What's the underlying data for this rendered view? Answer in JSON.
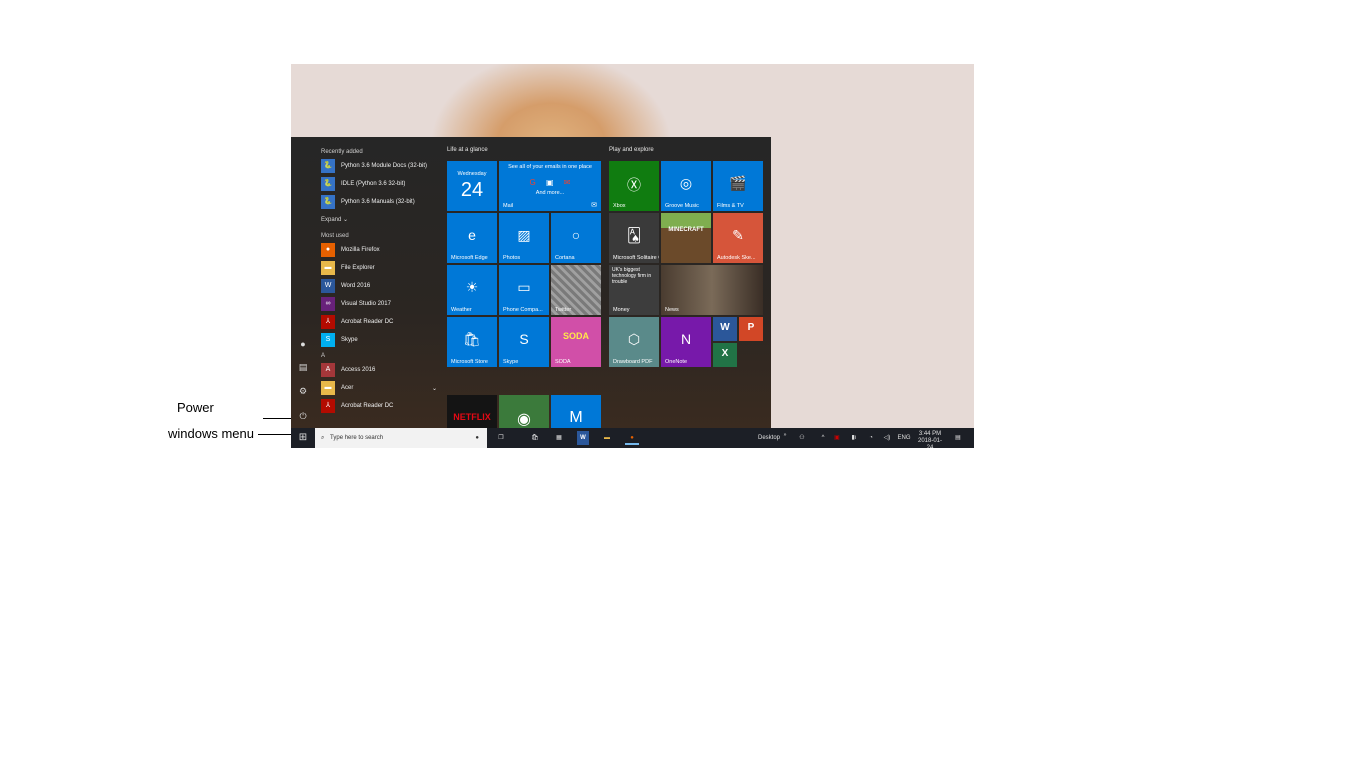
{
  "annotations": {
    "power": "Power",
    "windows_menu": "windows menu"
  },
  "start_menu": {
    "recently_added_header": "Recently added",
    "recently_added": [
      {
        "label": "Python 3.6 Module Docs (32-bit)",
        "icon": "python-icon",
        "color": "#3572c6"
      },
      {
        "label": "IDLE (Python 3.6 32-bit)",
        "icon": "python-icon",
        "color": "#3572c6"
      },
      {
        "label": "Python 3.6 Manuals (32-bit)",
        "icon": "python-icon",
        "color": "#3572c6"
      }
    ],
    "expand_label": "Expand ⌄",
    "most_used_header": "Most used",
    "most_used": [
      {
        "label": "Mozilla Firefox",
        "icon": "firefox-icon",
        "color": "#e66000"
      },
      {
        "label": "File Explorer",
        "icon": "folder-icon",
        "color": "#e8b84a"
      },
      {
        "label": "Word 2016",
        "icon": "word-icon",
        "color": "#2b579a"
      },
      {
        "label": "Visual Studio 2017",
        "icon": "visual-studio-icon",
        "color": "#68217a"
      },
      {
        "label": "Acrobat Reader DC",
        "icon": "acrobat-icon",
        "color": "#b30b00"
      },
      {
        "label": "Skype",
        "icon": "skype-icon",
        "color": "#00aff0"
      }
    ],
    "letter_a": "A",
    "a_apps": [
      {
        "label": "Access 2016",
        "icon": "access-icon",
        "color": "#a4373a"
      },
      {
        "label": "Acer",
        "icon": "folder-icon",
        "color": "#e8b84a",
        "chevron": "⌄"
      },
      {
        "label": "Acrobat Reader DC",
        "icon": "acrobat-icon",
        "color": "#b30b00"
      }
    ],
    "life_header": "Life at a glance",
    "play_header": "Play and explore",
    "calendar": {
      "day": "Wednesday",
      "date": "24"
    },
    "mail": {
      "text": "See all of your emails in one place",
      "more": "And more...",
      "label": "Mail"
    },
    "tiles_life": [
      {
        "key": "edge",
        "label": "Microsoft Edge",
        "glyph": "e",
        "icon": "edge-icon",
        "color": "#0078d7"
      },
      {
        "key": "photos",
        "label": "Photos",
        "glyph": "▨",
        "icon": "photos-icon",
        "color": "#0078d7"
      },
      {
        "key": "cortana",
        "label": "Cortana",
        "glyph": "○",
        "icon": "cortana-icon",
        "color": "#0078d7"
      },
      {
        "key": "weather",
        "label": "Weather",
        "glyph": "☀",
        "icon": "sun-icon",
        "color": "#0078d7"
      },
      {
        "key": "phone",
        "label": "Phone Compa...",
        "glyph": "▭",
        "icon": "phone-companion-icon",
        "color": "#0078d7"
      },
      {
        "key": "twitter",
        "label": "Twitter",
        "glyph": "",
        "icon": "twitter-icon",
        "color": "#8a8a8a"
      },
      {
        "key": "store",
        "label": "Microsoft Store",
        "glyph": "🛍",
        "icon": "store-icon",
        "color": "#0078d7"
      },
      {
        "key": "skype",
        "label": "Skype",
        "glyph": "S",
        "icon": "skype-icon",
        "color": "#0078d7"
      },
      {
        "key": "soda",
        "label": "SODA",
        "glyph": "SODA",
        "icon": "candy-crush-soda-icon",
        "color": "#d14fa8"
      }
    ],
    "tiles_play": [
      {
        "key": "xbox",
        "label": "Xbox",
        "glyph": "Ⓧ",
        "icon": "xbox-icon",
        "color": "#107c10"
      },
      {
        "key": "groove",
        "label": "Groove Music",
        "glyph": "◎",
        "icon": "groove-icon",
        "color": "#0078d7"
      },
      {
        "key": "films",
        "label": "Films & TV",
        "glyph": "🎬",
        "icon": "film-icon",
        "color": "#0078d7"
      },
      {
        "key": "solitaire",
        "label": "Microsoft Solitaire Collection",
        "glyph": "🂡",
        "icon": "solitaire-icon",
        "color": "#3a3a3a"
      },
      {
        "key": "minecraft",
        "label": "",
        "glyph": "MINECRAFT",
        "icon": "minecraft-icon",
        "color": "#6b8e3a"
      },
      {
        "key": "sketchbook",
        "label": "Autodesk Ske...",
        "glyph": "✎",
        "icon": "sketchbook-icon",
        "color": "#d6553a"
      },
      {
        "key": "money",
        "label": "Money",
        "glyph": "",
        "icon": "money-icon",
        "color": "#3d3d3d"
      },
      {
        "key": "news",
        "label": "News",
        "glyph": "",
        "icon": "news-icon",
        "color": "#5a4a3a"
      },
      {
        "key": "drawboard",
        "label": "Drawboard PDF",
        "glyph": "⬡",
        "icon": "drawboard-icon",
        "color": "#5a8a8a"
      },
      {
        "key": "onenote",
        "label": "OneNote",
        "glyph": "N",
        "icon": "onenote-icon",
        "color": "#7719aa"
      }
    ],
    "money_headline": "UK's biggest technology firm in trouble",
    "small_tiles": [
      {
        "key": "word",
        "glyph": "W",
        "icon": "word-icon",
        "color": "#2b579a"
      },
      {
        "key": "powerpoint",
        "glyph": "P",
        "icon": "powerpoint-icon",
        "color": "#d24726"
      },
      {
        "key": "excel",
        "glyph": "X",
        "icon": "excel-icon",
        "color": "#217346"
      }
    ],
    "bottom_tiles": [
      {
        "key": "netflix",
        "glyph": "NETFLIX",
        "icon": "netflix-icon",
        "color": "#141414"
      },
      {
        "key": "game",
        "glyph": "◉",
        "icon": "game-icon",
        "color": "#3b7a3b"
      },
      {
        "key": "mcafee",
        "glyph": "M",
        "icon": "mcafee-icon",
        "color": "#0078d7"
      }
    ]
  },
  "taskbar": {
    "search_placeholder": "Type here to search",
    "desktop_label": "Desktop",
    "language": "ENG",
    "time": "3:44 PM",
    "date": "2018-01-24"
  },
  "colors": {
    "accent": "#0078d7",
    "taskbar": "#1c1f26"
  }
}
